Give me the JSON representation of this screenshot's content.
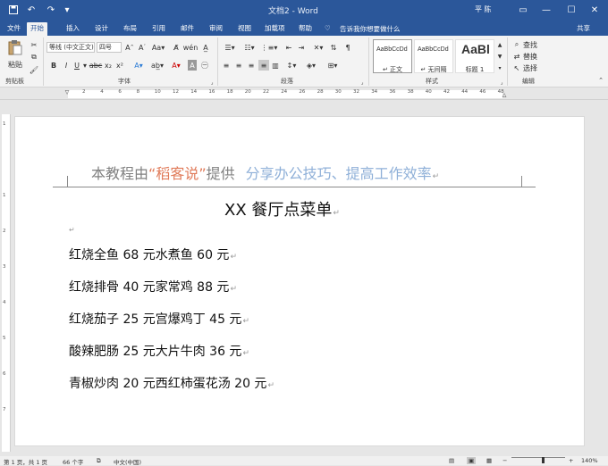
{
  "titlebar": {
    "doc_title": "文档2 - Word",
    "user": "平 陈",
    "save_icon": "save-icon",
    "undo_icon": "undo-icon",
    "redo_icon": "redo-icon"
  },
  "tabs": [
    "文件",
    "开始",
    "插入",
    "设计",
    "布局",
    "引用",
    "邮件",
    "审阅",
    "视图",
    "加载项",
    "帮助"
  ],
  "tell_me": "告诉我你想要做什么",
  "share": "共享",
  "ribbon": {
    "clipboard": {
      "paste": "粘贴",
      "label": "剪贴板"
    },
    "font": {
      "name": "等线 (中文正文)",
      "size": "四号",
      "label": "字体"
    },
    "paragraph": {
      "label": "段落"
    },
    "styles": {
      "items": [
        {
          "preview": "AaBbCcDd",
          "name": "↵ 正文"
        },
        {
          "preview": "AaBbCcDd",
          "name": "↵ 无间隔"
        },
        {
          "preview": "AaBl",
          "name": "标题 1"
        }
      ],
      "label": "样式"
    },
    "editing": {
      "find": "查找",
      "replace": "替换",
      "select": "选择",
      "label": "编辑"
    }
  },
  "ruler": {
    "numbers": [
      "2",
      "4",
      "6",
      "8",
      "10",
      "12",
      "14",
      "16",
      "18",
      "20",
      "22",
      "24",
      "26",
      "28",
      "30",
      "32",
      "34",
      "36",
      "38",
      "40",
      "42",
      "44",
      "46",
      "48"
    ]
  },
  "document": {
    "header": {
      "prefix": "本教程由",
      "quote_open": "“",
      "brand": "稻客说",
      "quote_close": "”",
      "provide": "提供",
      "slogan": "分享办公技巧、提高工作效率"
    },
    "title": "XX 餐厅点菜单",
    "menu_lines": [
      "红烧全鱼 68 元水煮鱼 60 元",
      "红烧排骨 40 元家常鸡 88 元",
      "红烧茄子 25 元宫爆鸡丁 45 元",
      "酸辣肥肠 25 元大片牛肉 36 元",
      "青椒炒肉 20 元西红柿蛋花汤 20 元"
    ],
    "paragraph_mark": "↵"
  },
  "statusbar": {
    "page": "第 1 页，共 1 页",
    "words": "66 个字",
    "language": "中文(中国)",
    "zoom": "140%"
  }
}
